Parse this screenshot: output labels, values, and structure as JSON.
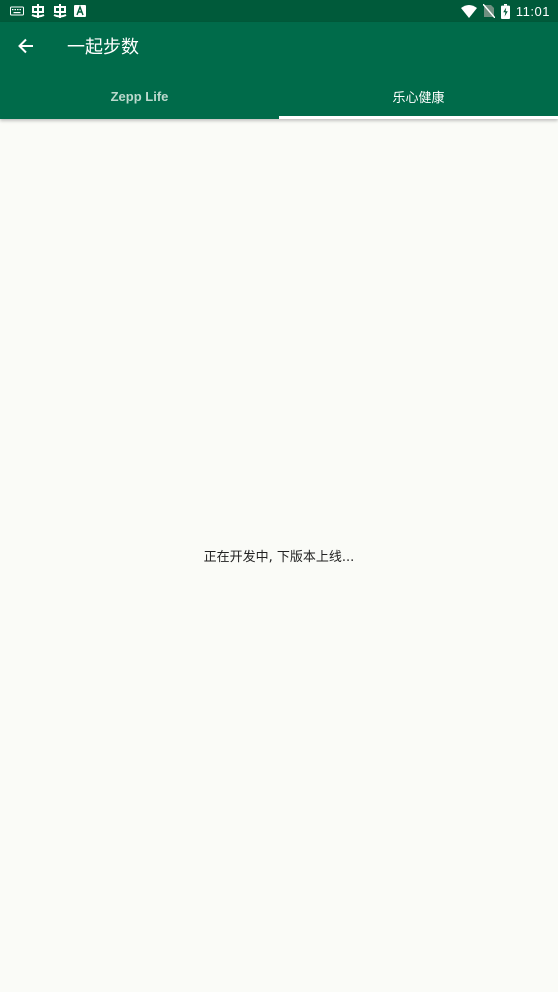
{
  "status_bar": {
    "time": "11:01",
    "left_icons": [
      "keyboard-icon",
      "bug-icon",
      "bug-icon",
      "a-box-icon"
    ],
    "right_icons": [
      "wifi-icon",
      "no-sim-icon",
      "battery-charging-icon"
    ]
  },
  "app_bar": {
    "title": "一起步数",
    "back_icon": "arrow-back-icon"
  },
  "tabs": [
    {
      "label": "Zepp Life",
      "active": false
    },
    {
      "label": "乐心健康",
      "active": true
    }
  ],
  "content": {
    "message": "正在开发中, 下版本上线..."
  },
  "colors": {
    "status_bar": "#005a3a",
    "app_bar": "#006b4a",
    "background": "#fafbf7",
    "tab_inactive": "#bcd9cd",
    "tab_active": "#ffffff"
  }
}
